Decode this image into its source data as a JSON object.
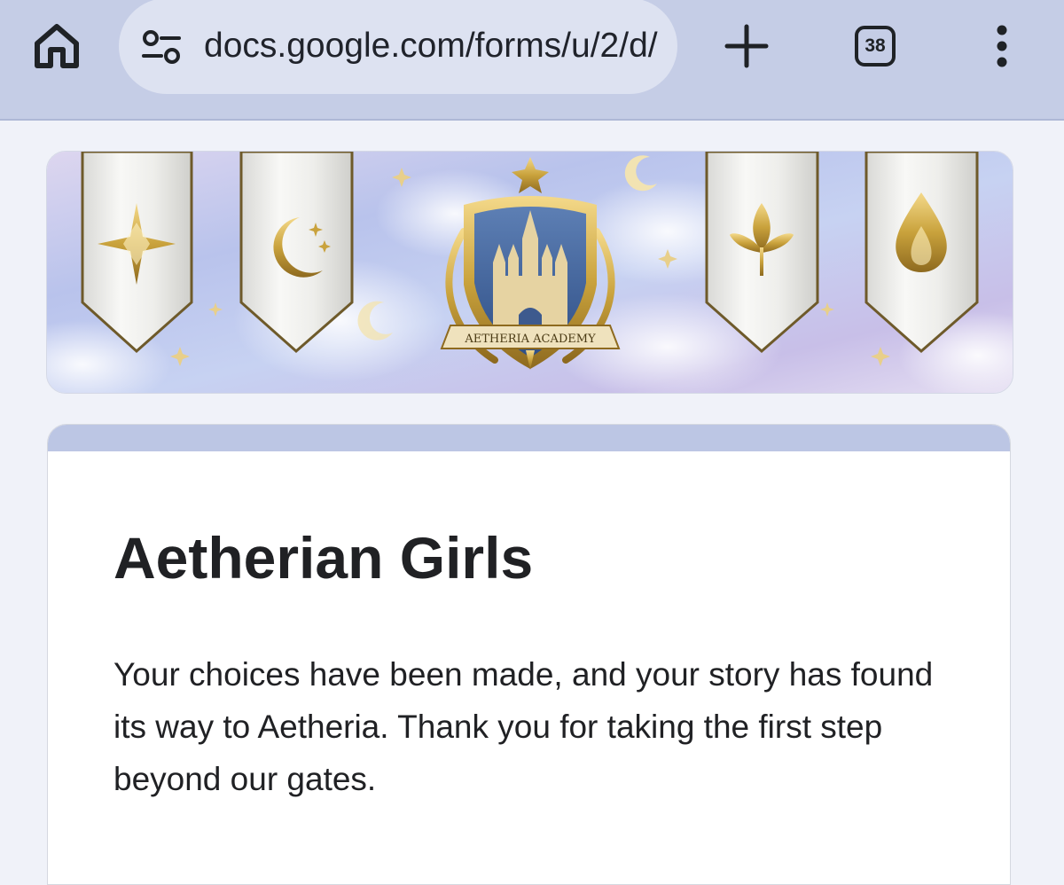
{
  "browser": {
    "url": "docs.google.com/forms/u/2/d/",
    "tab_count": "38",
    "icons": {
      "home": "home-icon",
      "site_info": "site-settings-icon",
      "new_tab": "plus-icon",
      "menu": "more-vert-icon"
    }
  },
  "banner": {
    "crest_text": "AETHERIA ACADEMY",
    "banner_emblems": [
      "compass-star",
      "crescent-moon",
      "leaf",
      "flame"
    ]
  },
  "form": {
    "title": "Aetherian Girls",
    "message": "Your choices have been made, and your story has found its way to Aetheria. Thank you for taking the first step beyond our gates."
  },
  "colors": {
    "toolbar_bg": "#c5cde6",
    "omnibox_bg": "#dde2f1",
    "page_bg": "#f0f2f9",
    "card_accent": "#bcc6e4",
    "text": "#202124",
    "gold": "#c9a23c"
  }
}
